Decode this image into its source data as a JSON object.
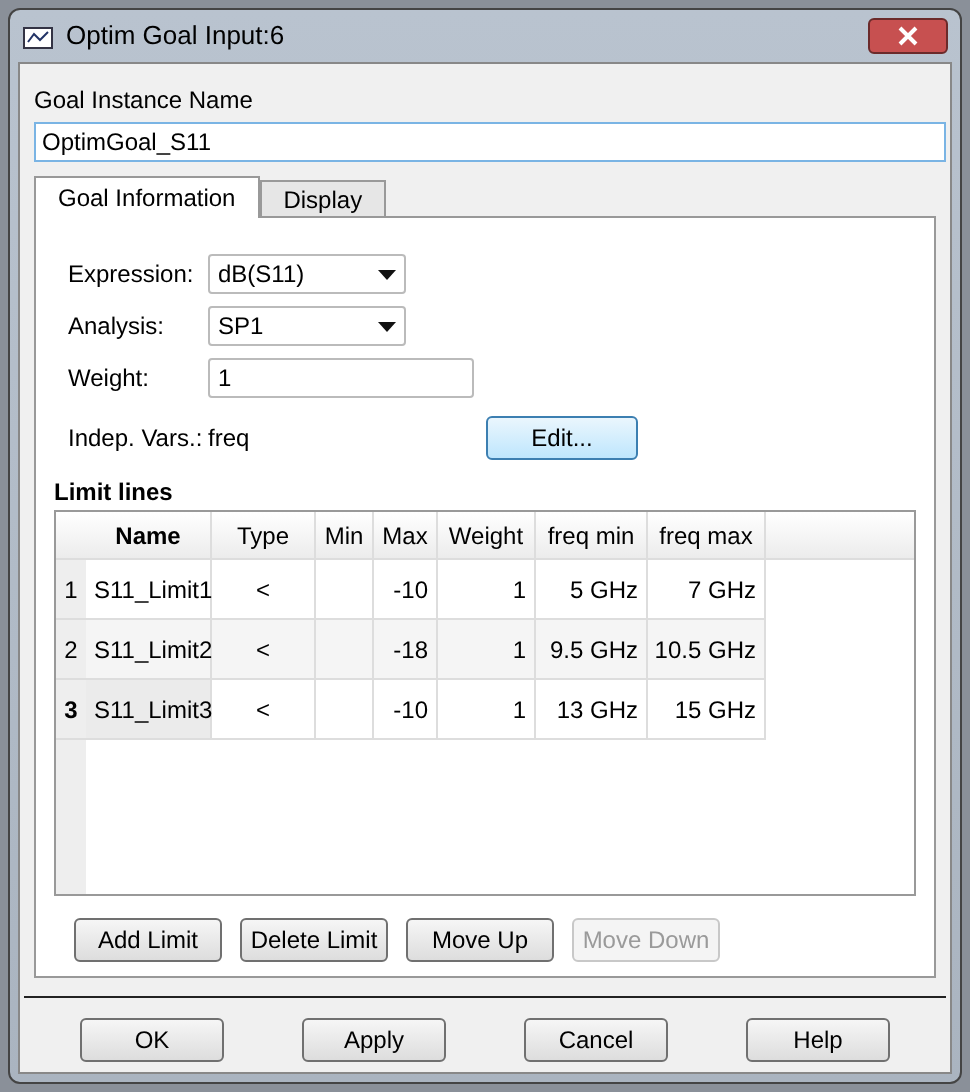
{
  "window": {
    "title": "Optim Goal Input:6"
  },
  "instance_name": {
    "label": "Goal Instance Name",
    "value": "OptimGoal_S11"
  },
  "tabs": [
    {
      "label": "Goal Information",
      "selected": true
    },
    {
      "label": "Display",
      "selected": false
    }
  ],
  "fields": [
    {
      "kind": "dropdown",
      "label": "Expression:",
      "value": "dB(S11)"
    },
    {
      "kind": "dropdown",
      "label": "Analysis:",
      "value": "SP1"
    },
    {
      "kind": "text",
      "label": "Weight:",
      "value": "1"
    }
  ],
  "indep_vars": {
    "label": "Indep. Vars.:",
    "value": "freq",
    "button": "Edit..."
  },
  "limit_lines": {
    "title": "Limit lines",
    "columns": [
      "Name",
      "Type",
      "Min",
      "Max",
      "Weight",
      "freq min",
      "freq max"
    ],
    "rows": [
      {
        "number": "1",
        "selected": false,
        "cells": [
          "S11_Limit1",
          "<",
          "",
          "-10",
          "1",
          "5 GHz",
          "7 GHz"
        ]
      },
      {
        "number": "2",
        "selected": false,
        "cells": [
          "S11_Limit2",
          "<",
          "",
          "-18",
          "1",
          "9.5 GHz",
          "10.5 GHz"
        ]
      },
      {
        "number": "3",
        "selected": true,
        "cells": [
          "S11_Limit3",
          "<",
          "",
          "-10",
          "1",
          "13 GHz",
          "15 GHz"
        ]
      }
    ],
    "buttons": [
      {
        "label": "Add Limit",
        "disabled": false
      },
      {
        "label": "Delete Limit",
        "disabled": false
      },
      {
        "label": "Move Up",
        "disabled": false
      },
      {
        "label": "Move Down",
        "disabled": true
      }
    ]
  },
  "buttons": [
    "OK",
    "Apply",
    "Cancel",
    "Help"
  ]
}
